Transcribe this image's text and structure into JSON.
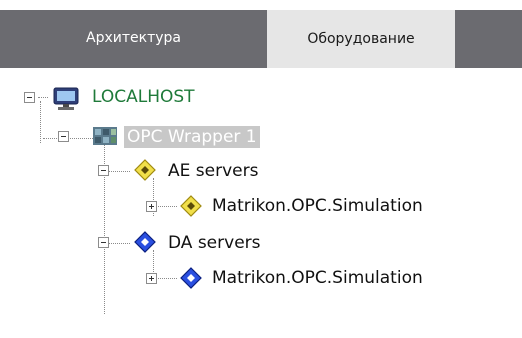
{
  "tabs": [
    {
      "label": "Архитектура",
      "active": false
    },
    {
      "label": "Оборудование",
      "active": true
    }
  ],
  "tree": {
    "root": {
      "label": "LOCALHOST",
      "icon": "computer-icon",
      "color": "#1f7a3a"
    },
    "wrapper": {
      "label": "OPC Wrapper 1",
      "icon": "opc-wrapper-icon",
      "selected": true
    },
    "ae_servers": {
      "label": "AE servers",
      "icon": "ae-server-icon",
      "color": "#e0c000"
    },
    "ae_child": {
      "label": "Matrikon.OPC.Simulation",
      "icon": "ae-server-icon"
    },
    "da_servers": {
      "label": "DA servers",
      "icon": "da-server-icon",
      "color": "#1a3fd6"
    },
    "da_child": {
      "label": "Matrikon.OPC.Simulation",
      "icon": "da-server-icon"
    }
  }
}
